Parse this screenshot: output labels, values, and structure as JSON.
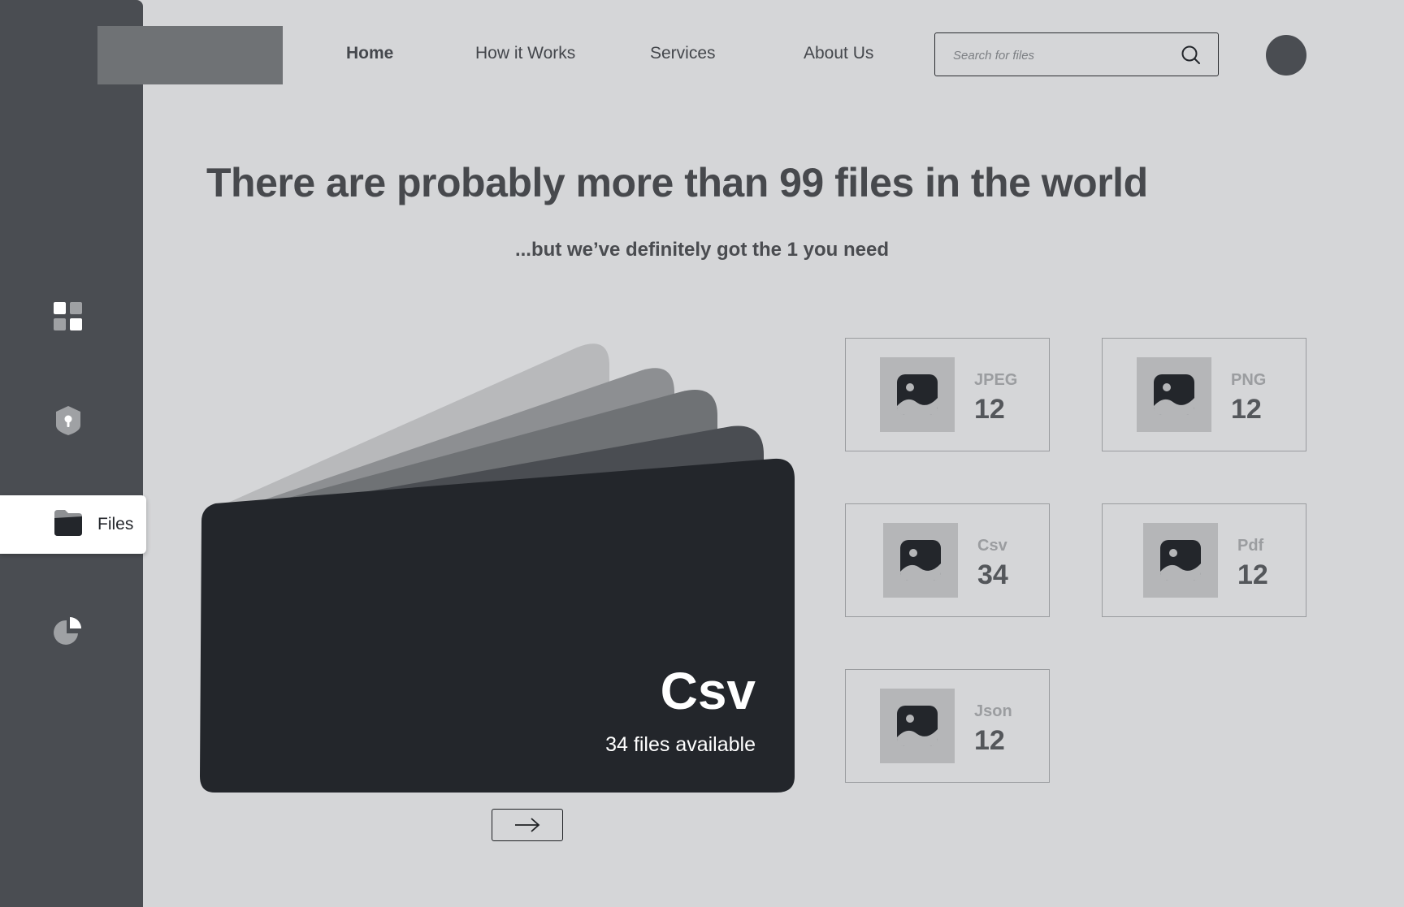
{
  "nav": {
    "items": [
      "Home",
      "How it Works",
      "Services",
      "About Us"
    ],
    "active": "Home"
  },
  "search": {
    "placeholder": "Search for files"
  },
  "sidebar": {
    "items": [
      {
        "icon": "dashboard-grid-icon",
        "label": ""
      },
      {
        "icon": "shield-lock-icon",
        "label": ""
      },
      {
        "icon": "folder-icon",
        "label": "Files"
      },
      {
        "icon": "pie-chart-icon",
        "label": ""
      }
    ],
    "active_label": "Files"
  },
  "hero": {
    "headline": "There are probably more than 99 files in the world",
    "subline": "...but we’ve definitely got the 1 you need"
  },
  "featured": {
    "title": "Csv",
    "subtitle": "34 files available"
  },
  "file_types": [
    {
      "type": "JPEG",
      "count": "12"
    },
    {
      "type": "PNG",
      "count": "12"
    },
    {
      "type": "Csv",
      "count": "34"
    },
    {
      "type": "Pdf",
      "count": "12"
    },
    {
      "type": "Json",
      "count": "12"
    }
  ],
  "colors": {
    "background": "#d5d6d8",
    "sidebar": "#4a4d52",
    "folder_front": "#23262b"
  }
}
